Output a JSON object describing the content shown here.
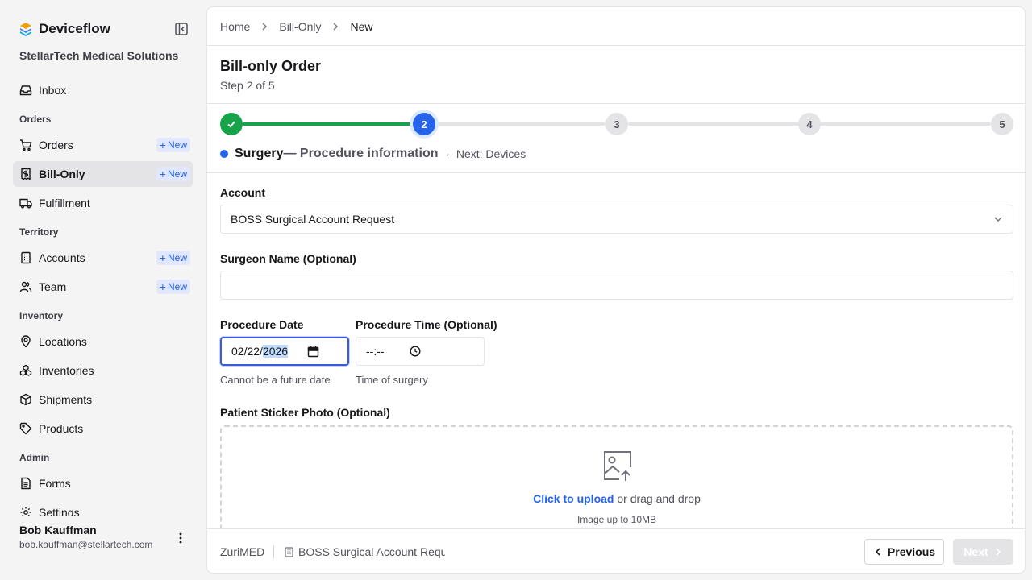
{
  "app": {
    "name": "Deviceflow",
    "org": "StellarTech Medical Solutions"
  },
  "sidebar": {
    "inbox": "Inbox",
    "sections": {
      "orders": "Orders",
      "territory": "Territory",
      "inventory": "Inventory",
      "admin": "Admin"
    },
    "items": {
      "orders": "Orders",
      "bill_only": "Bill-Only",
      "fulfillment": "Fulfillment",
      "accounts": "Accounts",
      "team": "Team",
      "locations": "Locations",
      "inventories": "Inventories",
      "shipments": "Shipments",
      "products": "Products",
      "forms": "Forms",
      "settings": "Settings"
    },
    "new_label": "New",
    "active_item": "Bill-Only"
  },
  "user": {
    "name": "Bob Kauffman",
    "email": "bob.kauffman@stellartech.com"
  },
  "breadcrumb": [
    "Home",
    "Bill-Only",
    "New"
  ],
  "page": {
    "title": "Bill-only Order",
    "subtitle": "Step 2 of 5"
  },
  "stepper": {
    "current_step": 2,
    "total_steps": 5,
    "steps": [
      "",
      "2",
      "3",
      "4",
      "5"
    ],
    "current_name": "Surgery",
    "current_desc": "— Procedure information",
    "separator": "·",
    "next_text": "Next: Devices"
  },
  "form": {
    "account": {
      "label": "Account",
      "value": "BOSS Surgical Account Request"
    },
    "surgeon": {
      "label": "Surgeon Name (Optional)",
      "value": ""
    },
    "procedure_date": {
      "label": "Procedure Date",
      "month": "02",
      "day": "22",
      "year": "2026",
      "hint": "Cannot be a future date"
    },
    "procedure_time": {
      "label": "Procedure Time (Optional)",
      "value": "--:--",
      "hint": "Time of surgery"
    },
    "sticker": {
      "label": "Patient Sticker Photo (Optional)",
      "upload_link": "Click to upload",
      "upload_rest": " or drag and drop",
      "upload_hint": "Image up to 10MB"
    }
  },
  "footer": {
    "vendor": "ZuriMED",
    "account": "BOSS Surgical Account Request",
    "previous": "Previous",
    "next": "Next"
  },
  "colors": {
    "primary": "#2563eb",
    "success": "#16a34a",
    "muted_line": "#e4e4e7"
  }
}
